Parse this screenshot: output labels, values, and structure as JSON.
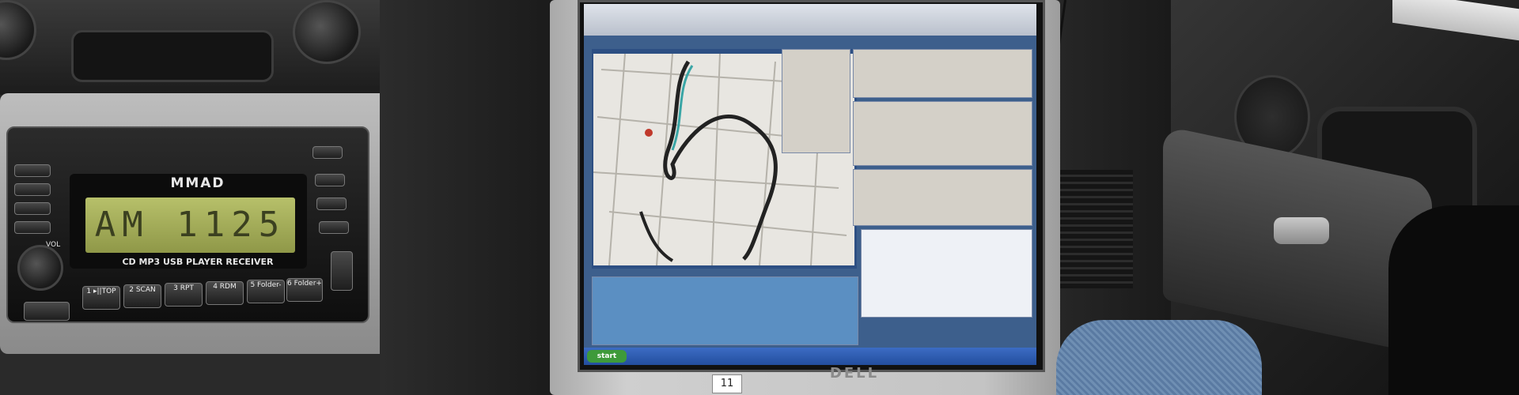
{
  "radio": {
    "brand": "MMAD",
    "display_text": "AM 1125",
    "caption": "CD MP3 USB PLAYER RECEIVER",
    "vol_label": "VOL",
    "preset_buttons": [
      "1 ▸||TOP",
      "2 SCAN",
      "3 RPT",
      "4 RDM",
      "5 Folder-",
      "6 Folder+"
    ]
  },
  "laptop": {
    "brand": "DELL",
    "asset_tag": "11",
    "taskbar_start": "start"
  }
}
